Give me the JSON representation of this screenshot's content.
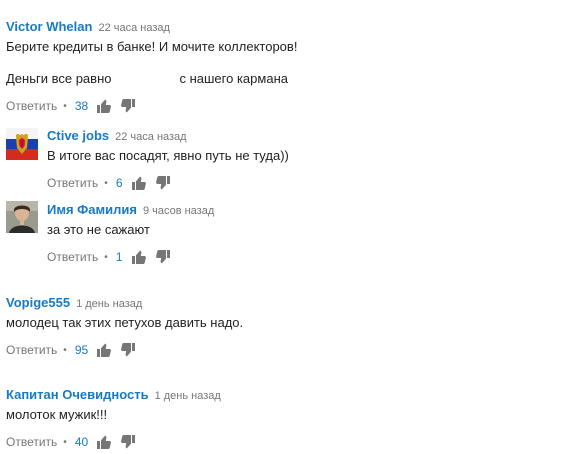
{
  "comments": [
    {
      "author": "Victor Whelan",
      "time": "22 часа назад",
      "lines": [
        "Берите кредиты в банке! И мочите коллекторов!"
      ],
      "line2_part1": "Деньги все равно",
      "line2_part2": "с нашего кармана",
      "reply_label": "Ответить",
      "likes": "38"
    },
    {
      "author": "Ctive jobs",
      "time": "22 часа назад",
      "text": "В итоге вас посадят, явно путь не туда))",
      "reply_label": "Ответить",
      "likes": "6"
    },
    {
      "author": "Имя Фамилия",
      "time": "9 часов назад",
      "text": "за это не сажают",
      "reply_label": "Ответить",
      "likes": "1"
    },
    {
      "author": "Vopige555",
      "time": "1 день назад",
      "text": "молодец так этих петухов давить надо.",
      "reply_label": "Ответить",
      "likes": "95"
    },
    {
      "author": "Капитан Очевидность",
      "time": "1 день назад",
      "text": "молоток мужик!!!",
      "reply_label": "Ответить",
      "likes": "40"
    }
  ],
  "separator": "•",
  "colors": {
    "author": "#167ac6",
    "likes": "#167ac6",
    "meta": "#767676",
    "text": "#222222",
    "thumb": "#767676"
  },
  "icons": {
    "thumb_up": "thumb-up-icon",
    "thumb_down": "thumb-down-icon",
    "avatar_flag": "russian-flag-coat-of-arms-avatar",
    "avatar_photo": "person-photo-avatar"
  }
}
